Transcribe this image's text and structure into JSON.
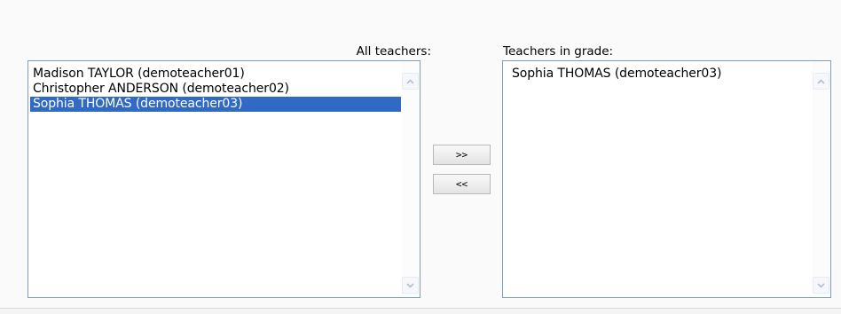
{
  "all_teachers": {
    "label": "All teachers:",
    "items": [
      {
        "label": "Madison TAYLOR (demoteacher01)",
        "selected": false
      },
      {
        "label": "Christopher ANDERSON (demoteacher02)",
        "selected": false
      },
      {
        "label": "Sophia THOMAS (demoteacher03)",
        "selected": true
      }
    ]
  },
  "teachers_in_grade": {
    "label": "Teachers in grade:",
    "items": [
      {
        "label": "Sophia THOMAS (demoteacher03)",
        "selected": false
      }
    ]
  },
  "buttons": {
    "add_label": ">>",
    "remove_label": "<<"
  },
  "icons": {
    "scroll_up": "chevron-up-icon",
    "scroll_down": "chevron-down-icon"
  },
  "colors": {
    "selection": "#316ac5",
    "listbox_border": "#7f9db9"
  }
}
